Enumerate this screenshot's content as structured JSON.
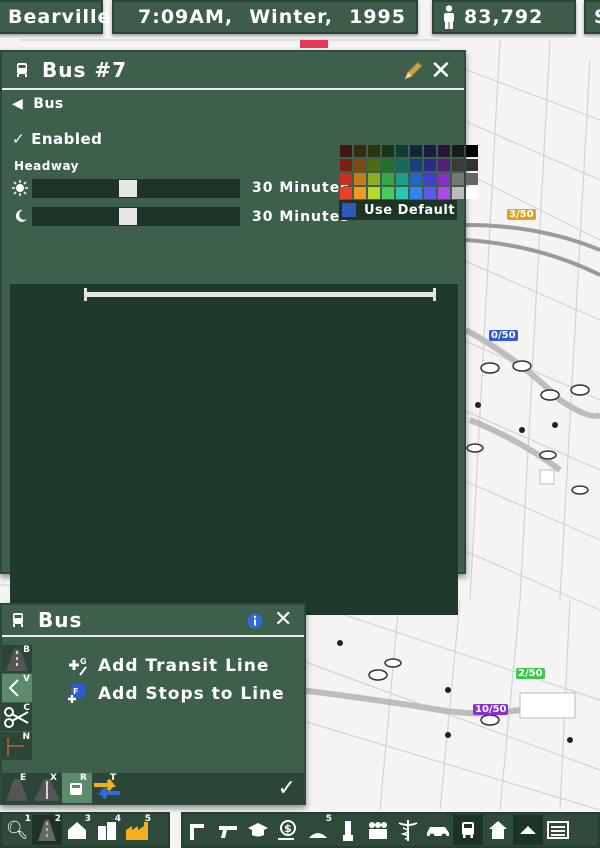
{
  "top_bar": {
    "city": "Bearville",
    "time": "7:09AM,",
    "season": "Winter,",
    "year": "1995",
    "population": "83,792",
    "extra": "S"
  },
  "line_panel": {
    "title": "Bus #7",
    "type_label": "Bus",
    "enabled_label": "Enabled",
    "headway_label": "Headway",
    "day_value": "30 Minutes",
    "night_value": "30 Minutes",
    "day_headway_fraction": 0.46,
    "night_headway_fraction": 0.46,
    "use_default_label": "Use Default",
    "palette": [
      "#3a1a12",
      "#3a2810",
      "#2b3510",
      "#193617",
      "#133a33",
      "#12253a",
      "#1b1a40",
      "#2b153a",
      "#1a1a1a",
      "#000000",
      "#7a1f17",
      "#7a4a10",
      "#4f6a15",
      "#23702a",
      "#146b5d",
      "#173f7a",
      "#2a2a8a",
      "#55207a",
      "#3b3b3b",
      "#333333",
      "#c43124",
      "#c77b18",
      "#8aad22",
      "#34a845",
      "#1c9e8b",
      "#2066c2",
      "#4040d0",
      "#8431c4",
      "#777777",
      "#666666",
      "#ef3d2c",
      "#f29a1f",
      "#b8d92b",
      "#4acb5c",
      "#27c8b0",
      "#2f86ee",
      "#5a5af2",
      "#a84bee",
      "#bbbbbb",
      "#ffffff"
    ]
  },
  "tool_panel": {
    "title": "Bus",
    "actions": [
      {
        "label": "Add Transit Line",
        "key": "G"
      },
      {
        "label": "Add Stops to Line",
        "key": "F"
      }
    ],
    "side_keys": [
      "B",
      "V",
      "C",
      "N"
    ],
    "bottom_keys": [
      "E",
      "X",
      "R",
      "T"
    ]
  },
  "bottom_toolbar": {
    "left_keys": [
      "1",
      "2",
      "3",
      "4",
      "5"
    ],
    "right_keys": [
      "5"
    ]
  },
  "map_badges": [
    {
      "text": "3/50",
      "color": "#e0a21a"
    },
    {
      "text": "0/50",
      "color": "#2f5bd0"
    },
    {
      "text": "2/50",
      "color": "#3cc84a"
    },
    {
      "text": "10/50",
      "color": "#8a2fd8"
    }
  ]
}
